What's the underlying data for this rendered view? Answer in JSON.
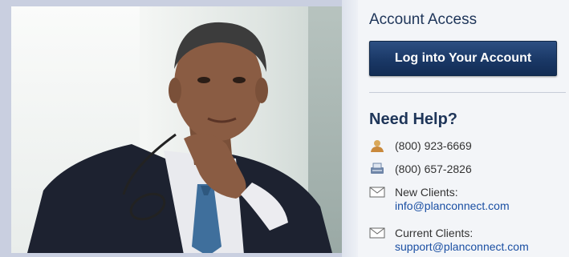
{
  "account": {
    "title": "Account Access",
    "login_label": "Log into Your Account"
  },
  "help": {
    "title": "Need Help?",
    "phone_1": "(800) 923-6669",
    "phone_2": "(800) 657-2826",
    "new_clients_label": "New Clients:",
    "new_clients_email": "info@planconnect.com",
    "current_clients_label": "Current Clients:",
    "current_clients_email": "support@planconnect.com"
  },
  "colors": {
    "heading": "#1e3559",
    "button": "#1a3866",
    "link": "#1a4fa3"
  },
  "icons": [
    "person-icon",
    "fax-icon",
    "envelope-icon",
    "envelope-icon"
  ]
}
